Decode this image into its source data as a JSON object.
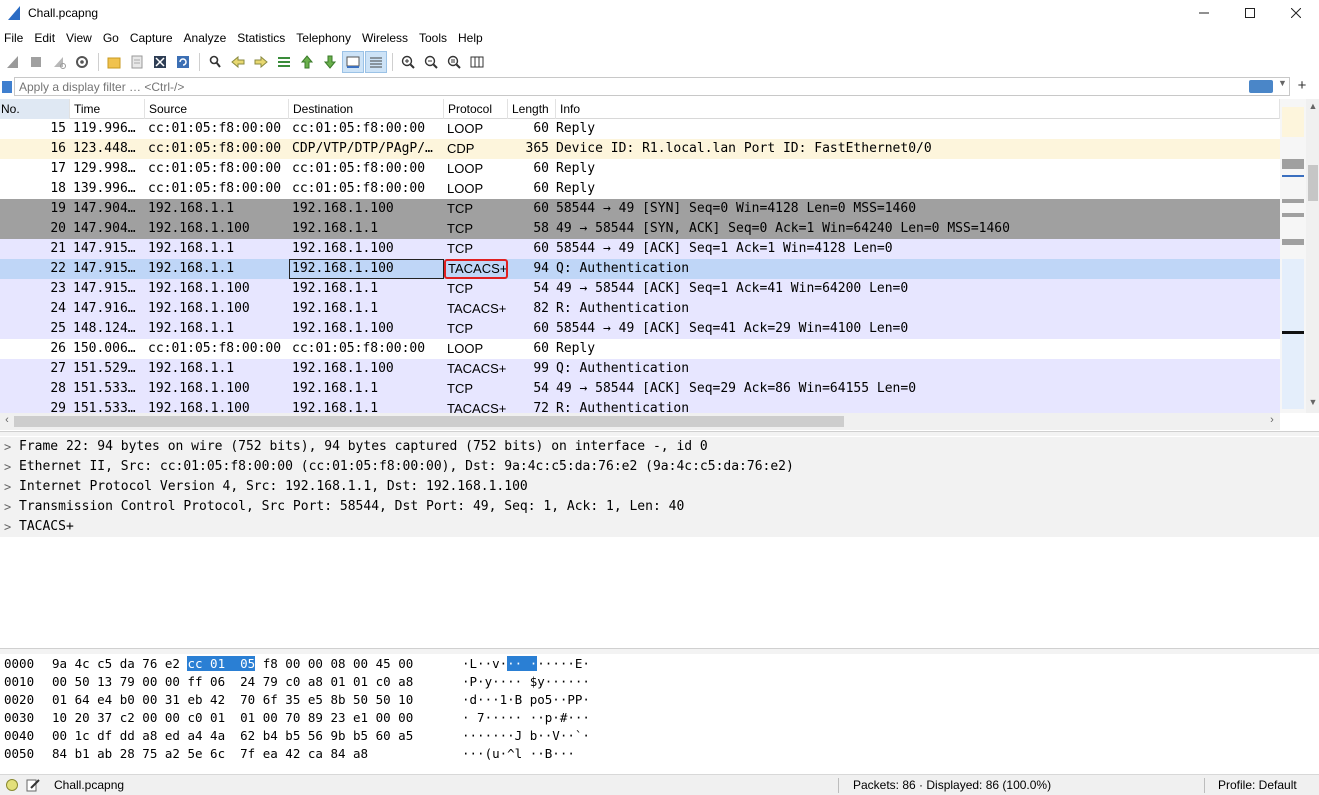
{
  "window": {
    "title": "Chall.pcapng"
  },
  "menu": [
    "File",
    "Edit",
    "View",
    "Go",
    "Capture",
    "Analyze",
    "Statistics",
    "Telephony",
    "Wireless",
    "Tools",
    "Help"
  ],
  "filter": {
    "placeholder": "Apply a display filter … <Ctrl-/>"
  },
  "packet_list": {
    "columns": [
      "No.",
      "Time",
      "Source",
      "Destination",
      "Protocol",
      "Length",
      "Info"
    ],
    "rows": [
      {
        "no": "15",
        "time": "119.996…",
        "src": "cc:01:05:f8:00:00",
        "dst": "cc:01:05:f8:00:00",
        "proto": "LOOP",
        "len": "60",
        "info": "Reply",
        "style": "white"
      },
      {
        "no": "16",
        "time": "123.448…",
        "src": "cc:01:05:f8:00:00",
        "dst": "CDP/VTP/DTP/PAgP/…",
        "proto": "CDP",
        "len": "365",
        "info": "Device ID: R1.local.lan  Port ID: FastEthernet0/0",
        "style": "yellow"
      },
      {
        "no": "17",
        "time": "129.998…",
        "src": "cc:01:05:f8:00:00",
        "dst": "cc:01:05:f8:00:00",
        "proto": "LOOP",
        "len": "60",
        "info": "Reply",
        "style": "white"
      },
      {
        "no": "18",
        "time": "139.996…",
        "src": "cc:01:05:f8:00:00",
        "dst": "cc:01:05:f8:00:00",
        "proto": "LOOP",
        "len": "60",
        "info": "Reply",
        "style": "white"
      },
      {
        "no": "19",
        "time": "147.904…",
        "src": "192.168.1.1",
        "dst": "192.168.1.100",
        "proto": "TCP",
        "len": "60",
        "info": "58544 → 49 [SYN] Seq=0 Win=4128 Len=0 MSS=1460",
        "style": "gray"
      },
      {
        "no": "20",
        "time": "147.904…",
        "src": "192.168.1.100",
        "dst": "192.168.1.1",
        "proto": "TCP",
        "len": "58",
        "info": "49 → 58544 [SYN, ACK] Seq=0 Ack=1 Win=64240 Len=0 MSS=1460",
        "style": "gray"
      },
      {
        "no": "21",
        "time": "147.915…",
        "src": "192.168.1.1",
        "dst": "192.168.1.100",
        "proto": "TCP",
        "len": "60",
        "info": "58544 → 49 [ACK] Seq=1 Ack=1 Win=4128 Len=0",
        "style": "lav"
      },
      {
        "no": "22",
        "time": "147.915…",
        "src": "192.168.1.1",
        "dst": "192.168.1.100",
        "proto": "TACACS+",
        "len": "94",
        "info": "Q: Authentication",
        "style": "sel"
      },
      {
        "no": "23",
        "time": "147.915…",
        "src": "192.168.1.100",
        "dst": "192.168.1.1",
        "proto": "TCP",
        "len": "54",
        "info": "49 → 58544 [ACK] Seq=1 Ack=41 Win=64200 Len=0",
        "style": "lav"
      },
      {
        "no": "24",
        "time": "147.916…",
        "src": "192.168.1.100",
        "dst": "192.168.1.1",
        "proto": "TACACS+",
        "len": "82",
        "info": "R: Authentication",
        "style": "lav"
      },
      {
        "no": "25",
        "time": "148.124…",
        "src": "192.168.1.1",
        "dst": "192.168.1.100",
        "proto": "TCP",
        "len": "60",
        "info": "58544 → 49 [ACK] Seq=41 Ack=29 Win=4100 Len=0",
        "style": "lav"
      },
      {
        "no": "26",
        "time": "150.006…",
        "src": "cc:01:05:f8:00:00",
        "dst": "cc:01:05:f8:00:00",
        "proto": "LOOP",
        "len": "60",
        "info": "Reply",
        "style": "white"
      },
      {
        "no": "27",
        "time": "151.529…",
        "src": "192.168.1.1",
        "dst": "192.168.1.100",
        "proto": "TACACS+",
        "len": "99",
        "info": "Q: Authentication",
        "style": "lav"
      },
      {
        "no": "28",
        "time": "151.533…",
        "src": "192.168.1.100",
        "dst": "192.168.1.1",
        "proto": "TCP",
        "len": "54",
        "info": "49 → 58544 [ACK] Seq=29 Ack=86 Win=64155 Len=0",
        "style": "lav"
      },
      {
        "no": "29",
        "time": "151.533…",
        "src": "192.168.1.100",
        "dst": "192.168.1.1",
        "proto": "TACACS+",
        "len": "72",
        "info": "R: Authentication",
        "style": "lav"
      }
    ]
  },
  "details": [
    "Frame 22: 94 bytes on wire (752 bits), 94 bytes captured (752 bits) on interface -, id 0",
    "Ethernet II, Src: cc:01:05:f8:00:00 (cc:01:05:f8:00:00), Dst: 9a:4c:c5:da:76:e2 (9a:4c:c5:da:76:e2)",
    "Internet Protocol Version 4, Src: 192.168.1.1, Dst: 192.168.1.100",
    "Transmission Control Protocol, Src Port: 58544, Dst Port: 49, Seq: 1, Ack: 1, Len: 40",
    "TACACS+"
  ],
  "bytes": [
    {
      "offset": "0000",
      "hex_pre": "9a 4c c5 da 76 e2 ",
      "hex_hl": "cc 01  05",
      "hex_post": " f8 00 00 08 00 45 00",
      "ascii_pre": "·L··v·",
      "ascii_hl": "·· ·",
      "ascii_post": "·····E·"
    },
    {
      "offset": "0010",
      "hex": "00 50 13 79 00 00 ff 06  24 79 c0 a8 01 01 c0 a8",
      "ascii": "·P·y···· $y······"
    },
    {
      "offset": "0020",
      "hex": "01 64 e4 b0 00 31 eb 42  70 6f 35 e5 8b 50 50 10",
      "ascii": "·d···1·B po5··PP·"
    },
    {
      "offset": "0030",
      "hex": "10 20 37 c2 00 00 c0 01  01 00 70 89 23 e1 00 00",
      "ascii": "· 7····· ··p·#···"
    },
    {
      "offset": "0040",
      "hex": "00 1c df dd a8 ed a4 4a  62 b4 b5 56 9b b5 60 a5",
      "ascii": "·······J b··V··`·"
    },
    {
      "offset": "0050",
      "hex": "84 b1 ab 28 75 a2 5e 6c  7f ea 42 ca 84 a8",
      "ascii": "···(u·^l ··B···"
    }
  ],
  "status": {
    "file": "Chall.pcapng",
    "packets": "Packets: 86 · Displayed: 86 (100.0%)",
    "profile": "Profile: Default"
  },
  "colors": {
    "selected_row": "#bfd6f7",
    "tcp_syn_row": "#a0a0a0",
    "tcp_row": "#e7e6ff",
    "cdp_row": "#fdf5dc",
    "highlight_box": "#e02020",
    "byte_highlight": "#2a7fd4"
  }
}
